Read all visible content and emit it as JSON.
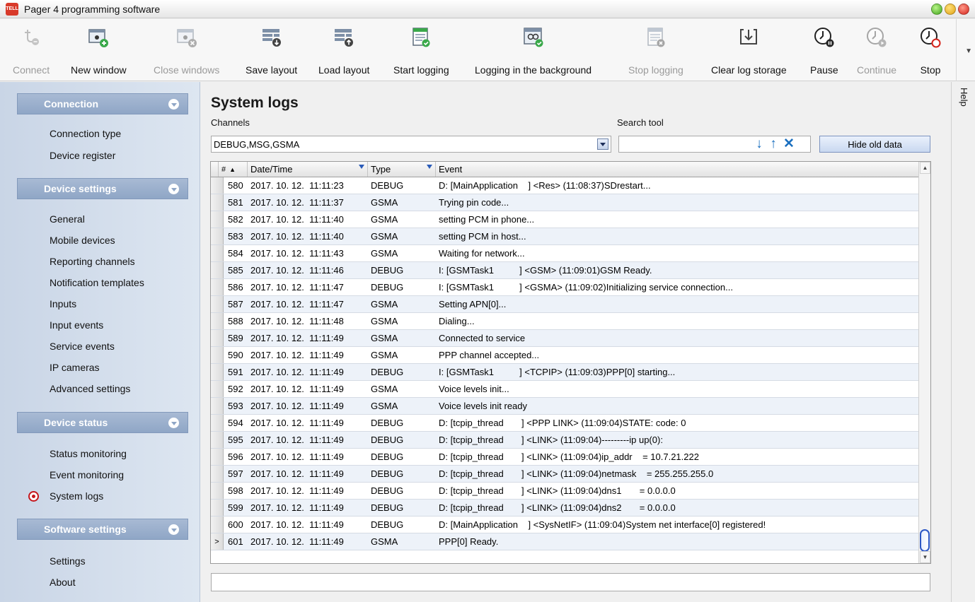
{
  "window": {
    "title": "Pager 4 programming software",
    "app_icon_text": "TELL"
  },
  "toolbar": [
    {
      "label": "Connect",
      "icon": "usb-plug-icon",
      "enabled": false
    },
    {
      "label": "New window",
      "icon": "new-window-icon",
      "enabled": true
    },
    {
      "label": "Close windows",
      "icon": "close-windows-icon",
      "enabled": false
    },
    {
      "label": "Save layout",
      "icon": "save-layout-icon",
      "enabled": true
    },
    {
      "label": "Load layout",
      "icon": "load-layout-icon",
      "enabled": true
    },
    {
      "label": "Start logging",
      "icon": "start-logging-icon",
      "enabled": true
    },
    {
      "label": "Logging in the background",
      "icon": "background-logging-icon",
      "enabled": true
    },
    {
      "label": "Stop logging",
      "icon": "stop-logging-icon",
      "enabled": false
    },
    {
      "label": "Clear log storage",
      "icon": "clear-log-storage-icon",
      "enabled": true
    },
    {
      "label": "Pause",
      "icon": "pause-clock-icon",
      "enabled": true
    },
    {
      "label": "Continue",
      "icon": "continue-clock-icon",
      "enabled": false
    },
    {
      "label": "Stop",
      "icon": "stop-clock-icon",
      "enabled": true
    }
  ],
  "sidebar": {
    "sections": [
      {
        "title": "Connection",
        "items": [
          "Connection type",
          "Device register"
        ]
      },
      {
        "title": "Device settings",
        "items": [
          "General",
          "Mobile devices",
          "Reporting channels",
          "Notification templates",
          "Inputs",
          "Input events",
          "Service events",
          "IP cameras",
          "Advanced settings"
        ]
      },
      {
        "title": "Device status",
        "items": [
          "Status monitoring",
          "Event monitoring",
          "System logs"
        ]
      },
      {
        "title": "Software settings",
        "items": [
          "Settings",
          "About"
        ]
      }
    ],
    "selected": "System logs"
  },
  "main": {
    "title": "System logs",
    "channels_label": "Channels",
    "channels_value": "DEBUG,MSG,GSMA",
    "search_label": "Search tool",
    "search_value": "",
    "search_controls": [
      "↓",
      "↑",
      "✕"
    ],
    "hide_old_data_label": "Hide old data",
    "help_label": "Help"
  },
  "table": {
    "columns": [
      "",
      "#",
      "Date/Time",
      "Type",
      "Event"
    ],
    "rows": [
      [
        "580",
        "2017. 10. 12.  11:11:23",
        "DEBUG",
        "D: [MainApplication    ] <Res> (11:08:37)SDrestart..."
      ],
      [
        "581",
        "2017. 10. 12.  11:11:37",
        "GSMA",
        "Trying pin code..."
      ],
      [
        "582",
        "2017. 10. 12.  11:11:40",
        "GSMA",
        "setting PCM in phone..."
      ],
      [
        "583",
        "2017. 10. 12.  11:11:40",
        "GSMA",
        "setting PCM in host..."
      ],
      [
        "584",
        "2017. 10. 12.  11:11:43",
        "GSMA",
        "Waiting for network..."
      ],
      [
        "585",
        "2017. 10. 12.  11:11:46",
        "DEBUG",
        "I: [GSMTask1          ] <GSM> (11:09:01)GSM Ready."
      ],
      [
        "586",
        "2017. 10. 12.  11:11:47",
        "DEBUG",
        "I: [GSMTask1          ] <GSMA> (11:09:02)Initializing service connection..."
      ],
      [
        "587",
        "2017. 10. 12.  11:11:47",
        "GSMA",
        "Setting APN[0]..."
      ],
      [
        "588",
        "2017. 10. 12.  11:11:48",
        "GSMA",
        "Dialing..."
      ],
      [
        "589",
        "2017. 10. 12.  11:11:49",
        "GSMA",
        "Connected to service"
      ],
      [
        "590",
        "2017. 10. 12.  11:11:49",
        "GSMA",
        "PPP channel accepted..."
      ],
      [
        "591",
        "2017. 10. 12.  11:11:49",
        "DEBUG",
        "I: [GSMTask1          ] <TCPIP> (11:09:03)PPP[0] starting..."
      ],
      [
        "592",
        "2017. 10. 12.  11:11:49",
        "GSMA",
        "Voice levels init..."
      ],
      [
        "593",
        "2017. 10. 12.  11:11:49",
        "GSMA",
        "Voice levels init ready"
      ],
      [
        "594",
        "2017. 10. 12.  11:11:49",
        "DEBUG",
        "D: [tcpip_thread       ] <PPP LINK> (11:09:04)STATE: code: 0"
      ],
      [
        "595",
        "2017. 10. 12.  11:11:49",
        "DEBUG",
        "D: [tcpip_thread       ] <LINK> (11:09:04)---------ip up(0):"
      ],
      [
        "596",
        "2017. 10. 12.  11:11:49",
        "DEBUG",
        "D: [tcpip_thread       ] <LINK> (11:09:04)ip_addr    = 10.7.21.222"
      ],
      [
        "597",
        "2017. 10. 12.  11:11:49",
        "DEBUG",
        "D: [tcpip_thread       ] <LINK> (11:09:04)netmask    = 255.255.255.0"
      ],
      [
        "598",
        "2017. 10. 12.  11:11:49",
        "DEBUG",
        "D: [tcpip_thread       ] <LINK> (11:09:04)dns1       = 0.0.0.0"
      ],
      [
        "599",
        "2017. 10. 12.  11:11:49",
        "DEBUG",
        "D: [tcpip_thread       ] <LINK> (11:09:04)dns2       = 0.0.0.0"
      ],
      [
        "600",
        "2017. 10. 12.  11:11:49",
        "DEBUG",
        "D: [MainApplication    ] <SysNetIF> (11:09:04)System net interface[0] registered!"
      ],
      [
        "601",
        "2017. 10. 12.  11:11:49",
        "GSMA",
        "PPP[0] Ready."
      ]
    ],
    "current_row_marker": ">"
  },
  "status_input_value": "",
  "colors": {
    "section_header": "#8fa6c6",
    "sidebar_bg": "#d3ddec",
    "selected_radio": "#c4161c",
    "row_alt": "#edf2f9",
    "accent_blue": "#2c57c5"
  }
}
